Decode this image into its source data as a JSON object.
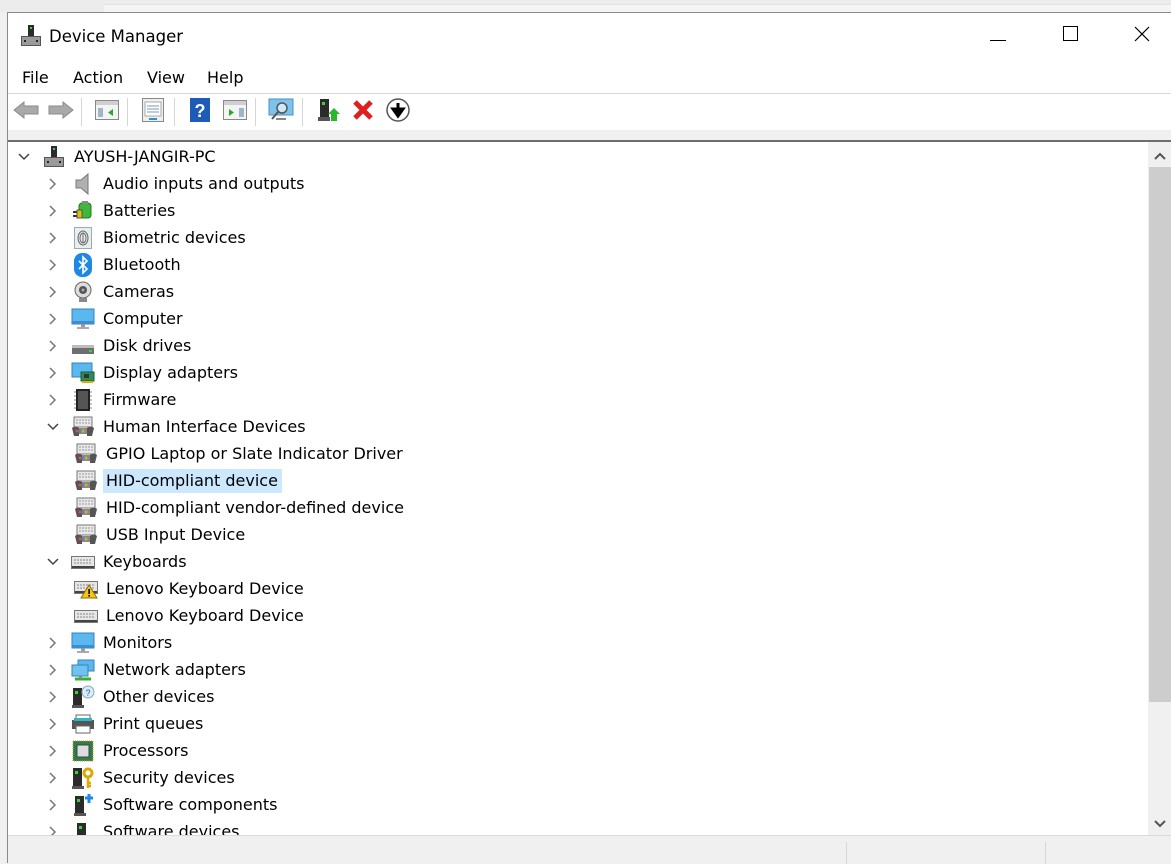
{
  "window": {
    "title": "Device Manager",
    "app_icon": "device-manager-icon",
    "controls": {
      "minimize": "minimize-icon",
      "maximize": "maximize-icon",
      "close": "close-icon"
    }
  },
  "menu": [
    "File",
    "Action",
    "View",
    "Help"
  ],
  "toolbar": [
    {
      "name": "back-button",
      "icon": "back-arrow-icon"
    },
    {
      "name": "forward-button",
      "icon": "forward-arrow-icon"
    },
    {
      "name": "show-hide-console-tree-button",
      "icon": "console-tree-icon"
    },
    {
      "name": "properties-button",
      "icon": "properties-icon"
    },
    {
      "name": "help-button",
      "icon": "help-icon"
    },
    {
      "name": "show-hide-action-pane-button",
      "icon": "action-pane-icon"
    },
    {
      "name": "scan-hardware-changes-button",
      "icon": "scan-monitor-icon"
    },
    {
      "name": "update-driver-button",
      "icon": "update-driver-icon"
    },
    {
      "name": "uninstall-device-button",
      "icon": "red-x-icon"
    },
    {
      "name": "disable-device-button",
      "icon": "down-arrow-circle-icon"
    }
  ],
  "tree": {
    "root": {
      "label": "AYUSH-JANGIR-PC",
      "icon": "computer-tower-icon",
      "expanded": true
    },
    "nodes": [
      {
        "label": "Audio inputs and outputs",
        "icon": "speaker-icon",
        "level": 1,
        "expander": "collapsed"
      },
      {
        "label": "Batteries",
        "icon": "battery-icon",
        "level": 1,
        "expander": "collapsed"
      },
      {
        "label": "Biometric devices",
        "icon": "fingerprint-icon",
        "level": 1,
        "expander": "collapsed"
      },
      {
        "label": "Bluetooth",
        "icon": "bluetooth-icon",
        "level": 1,
        "expander": "collapsed"
      },
      {
        "label": "Cameras",
        "icon": "webcam-icon",
        "level": 1,
        "expander": "collapsed"
      },
      {
        "label": "Computer",
        "icon": "monitor-icon",
        "level": 1,
        "expander": "collapsed"
      },
      {
        "label": "Disk drives",
        "icon": "disk-drive-icon",
        "level": 1,
        "expander": "collapsed"
      },
      {
        "label": "Display adapters",
        "icon": "display-adapter-icon",
        "level": 1,
        "expander": "collapsed"
      },
      {
        "label": "Firmware",
        "icon": "chip-icon",
        "level": 1,
        "expander": "collapsed"
      },
      {
        "label": "Human Interface Devices",
        "icon": "hid-icon",
        "level": 1,
        "expander": "expanded"
      },
      {
        "label": "GPIO Laptop or Slate Indicator Driver",
        "icon": "hid-icon",
        "level": 2,
        "expander": "none"
      },
      {
        "label": "HID-compliant device",
        "icon": "hid-icon",
        "level": 2,
        "expander": "none",
        "selected": true
      },
      {
        "label": "HID-compliant vendor-defined device",
        "icon": "hid-icon",
        "level": 2,
        "expander": "none"
      },
      {
        "label": "USB Input Device",
        "icon": "hid-icon",
        "level": 2,
        "expander": "none"
      },
      {
        "label": "Keyboards",
        "icon": "keyboard-icon",
        "level": 1,
        "expander": "expanded"
      },
      {
        "label": "Lenovo Keyboard Device",
        "icon": "keyboard-warning-icon",
        "level": 2,
        "expander": "none",
        "status": "warning"
      },
      {
        "label": "Lenovo Keyboard Device",
        "icon": "keyboard-icon",
        "level": 2,
        "expander": "none"
      },
      {
        "label": "Monitors",
        "icon": "monitor-icon",
        "level": 1,
        "expander": "collapsed"
      },
      {
        "label": "Network adapters",
        "icon": "network-adapter-icon",
        "level": 1,
        "expander": "collapsed"
      },
      {
        "label": "Other devices",
        "icon": "unknown-device-icon",
        "level": 1,
        "expander": "collapsed"
      },
      {
        "label": "Print queues",
        "icon": "printer-icon",
        "level": 1,
        "expander": "collapsed"
      },
      {
        "label": "Processors",
        "icon": "processor-icon",
        "level": 1,
        "expander": "collapsed"
      },
      {
        "label": "Security devices",
        "icon": "security-key-icon",
        "level": 1,
        "expander": "collapsed"
      },
      {
        "label": "Software components",
        "icon": "software-component-icon",
        "level": 1,
        "expander": "collapsed"
      },
      {
        "label": "Software devices",
        "icon": "software-device-icon",
        "level": 1,
        "expander": "collapsed"
      }
    ]
  },
  "scrollbar": {
    "position_fraction": 0.0,
    "visible_fraction": 0.81
  },
  "colors": {
    "selection": "#cce8ff",
    "accent_green": "#2db52d",
    "delete_red": "#e01f1f",
    "help_blue": "#1e5bb8"
  }
}
